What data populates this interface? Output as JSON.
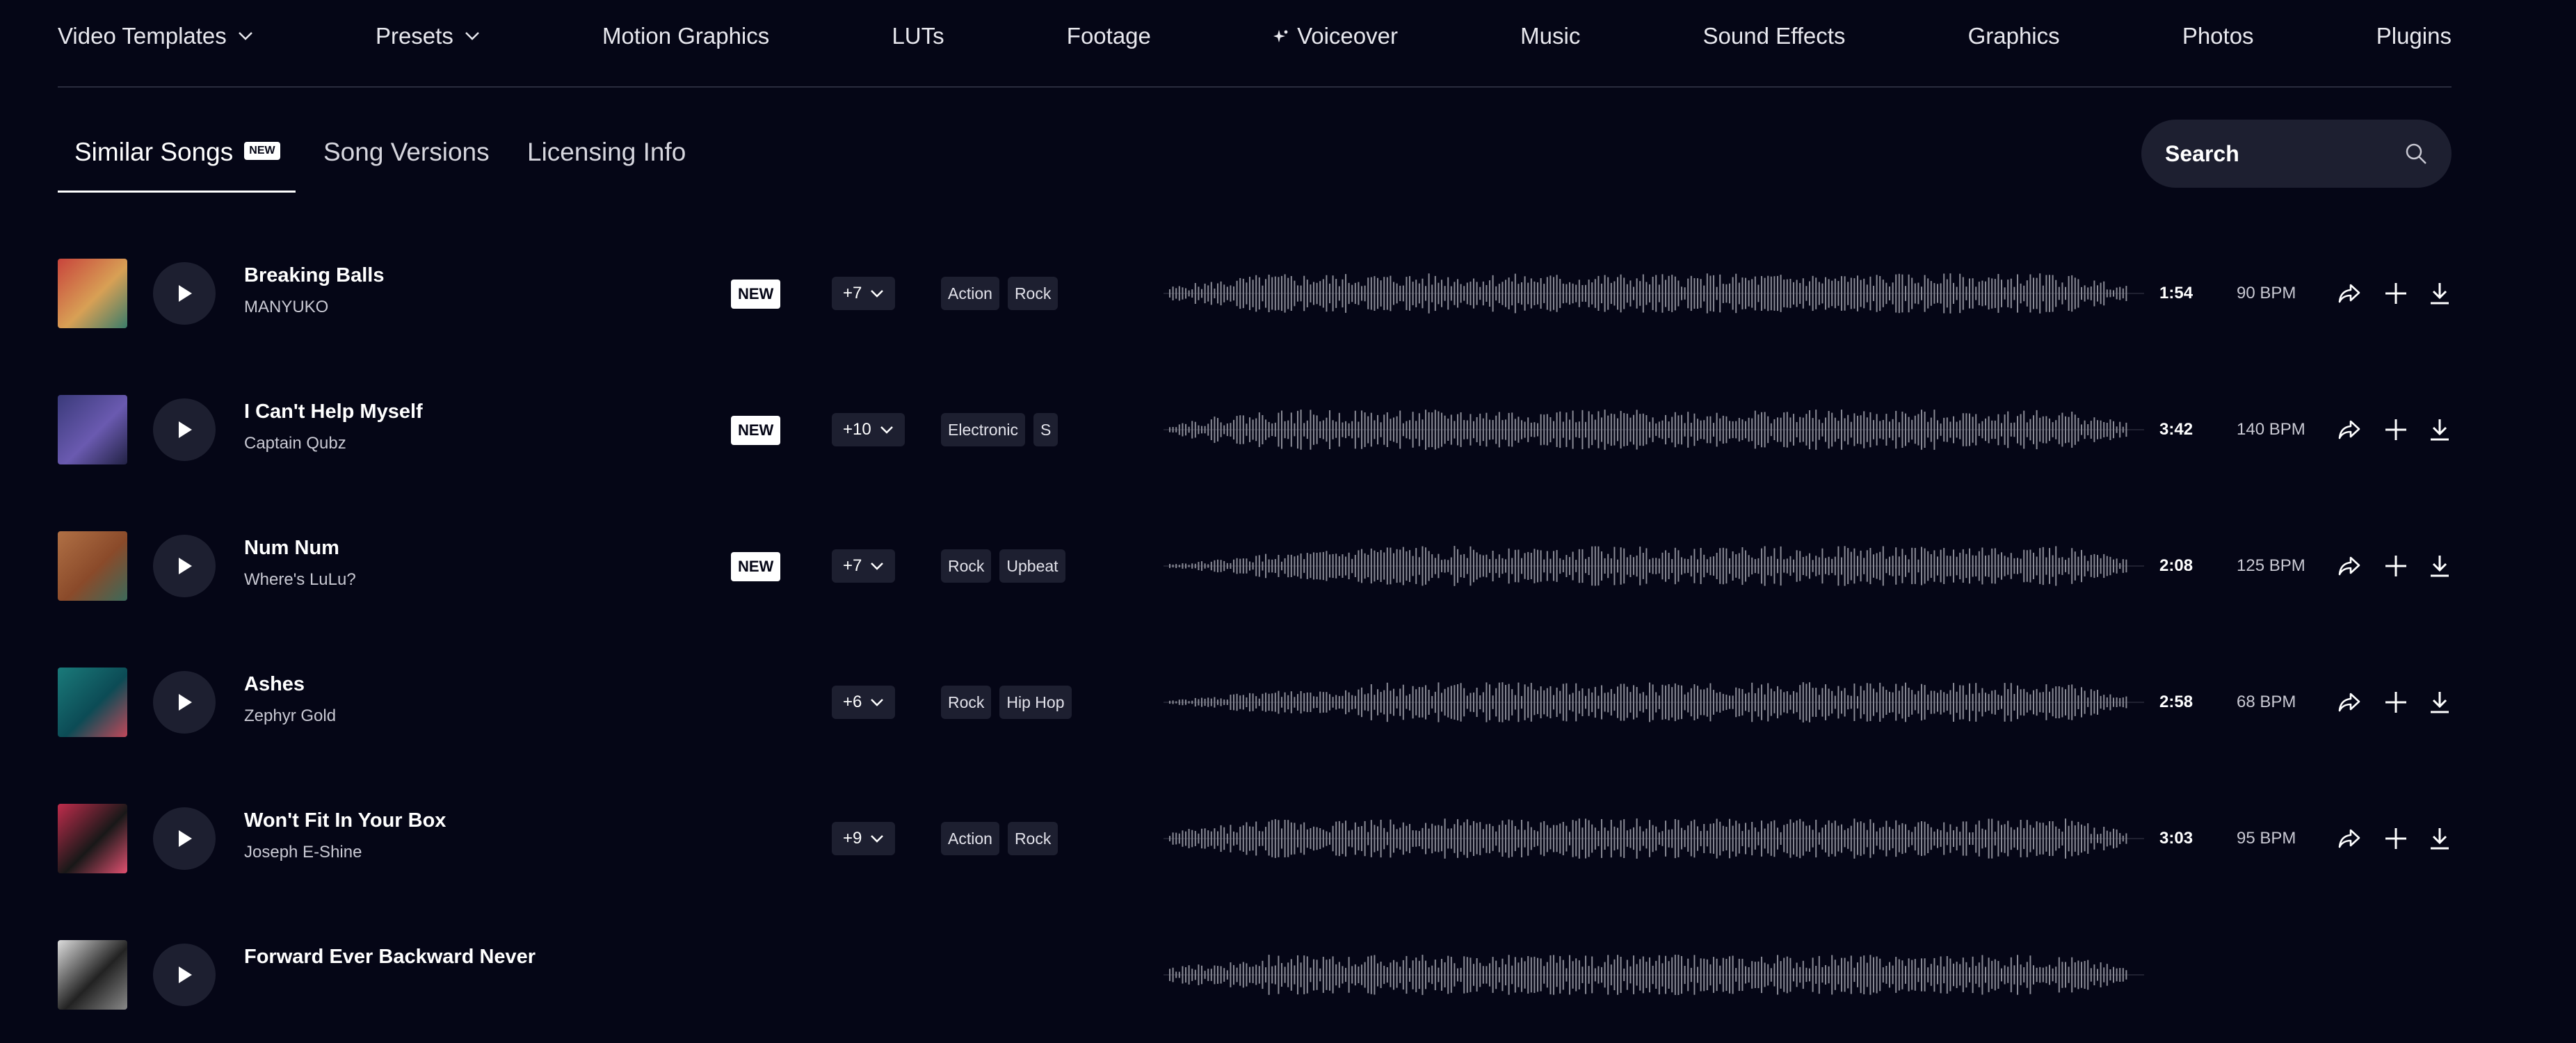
{
  "nav": {
    "items": [
      {
        "label": "Video Templates",
        "has_dropdown": true
      },
      {
        "label": "Presets",
        "has_dropdown": true
      },
      {
        "label": "Motion Graphics"
      },
      {
        "label": "LUTs"
      },
      {
        "label": "Footage"
      },
      {
        "label": "Voiceover",
        "icon": "sparkle-icon"
      },
      {
        "label": "Music"
      },
      {
        "label": "Sound Effects"
      },
      {
        "label": "Graphics"
      },
      {
        "label": "Photos"
      },
      {
        "label": "Plugins"
      }
    ]
  },
  "tabs": [
    {
      "label": "Similar Songs",
      "badge": "NEW",
      "active": true
    },
    {
      "label": "Song Versions"
    },
    {
      "label": "Licensing Info"
    }
  ],
  "search": {
    "placeholder": "Search"
  },
  "colors": {
    "background": "#050616",
    "surface": "#1d1f30",
    "waveform": "#8a8b96",
    "text": "#ffffff"
  },
  "songs": [
    {
      "title": "Breaking Balls",
      "artist": "MANYUKO",
      "badge": "NEW",
      "more": "+7",
      "tags": [
        "Action",
        "Rock"
      ],
      "duration": "1:54",
      "bpm": "90 BPM",
      "thumb": [
        "#c8443c",
        "#d8a055",
        "#3a7c6a"
      ]
    },
    {
      "title": "I Can't Help Myself",
      "artist": "Captain Qubz",
      "badge": "NEW",
      "more": "+10",
      "tags": [
        "Electronic",
        "S"
      ],
      "duration": "3:42",
      "bpm": "140 BPM",
      "thumb": [
        "#3a3a7a",
        "#6a5ab0",
        "#222244"
      ]
    },
    {
      "title": "Num Num",
      "artist": "Where's LuLu?",
      "badge": "NEW",
      "more": "+7",
      "tags": [
        "Rock",
        "Upbeat"
      ],
      "duration": "2:08",
      "bpm": "125 BPM",
      "thumb": [
        "#b07045",
        "#8a4a2a",
        "#3c6a5a"
      ]
    },
    {
      "title": "Ashes",
      "artist": "Zephyr Gold",
      "badge": "",
      "more": "+6",
      "tags": [
        "Rock",
        "Hip Hop"
      ],
      "duration": "2:58",
      "bpm": "68 BPM",
      "thumb": [
        "#1a7a7a",
        "#0c4b55",
        "#c0485a"
      ]
    },
    {
      "title": "Won't Fit In Your Box",
      "artist": "Joseph E-Shine",
      "badge": "",
      "more": "+9",
      "tags": [
        "Action",
        "Rock"
      ],
      "duration": "3:03",
      "bpm": "95 BPM",
      "thumb": [
        "#c02c4c",
        "#181818",
        "#e05070"
      ]
    },
    {
      "title": "Forward Ever Backward Never",
      "artist": "",
      "badge": "",
      "more": "",
      "tags": [],
      "duration": "",
      "bpm": "",
      "thumb": [
        "#dddddd",
        "#222222",
        "#888888"
      ]
    }
  ]
}
